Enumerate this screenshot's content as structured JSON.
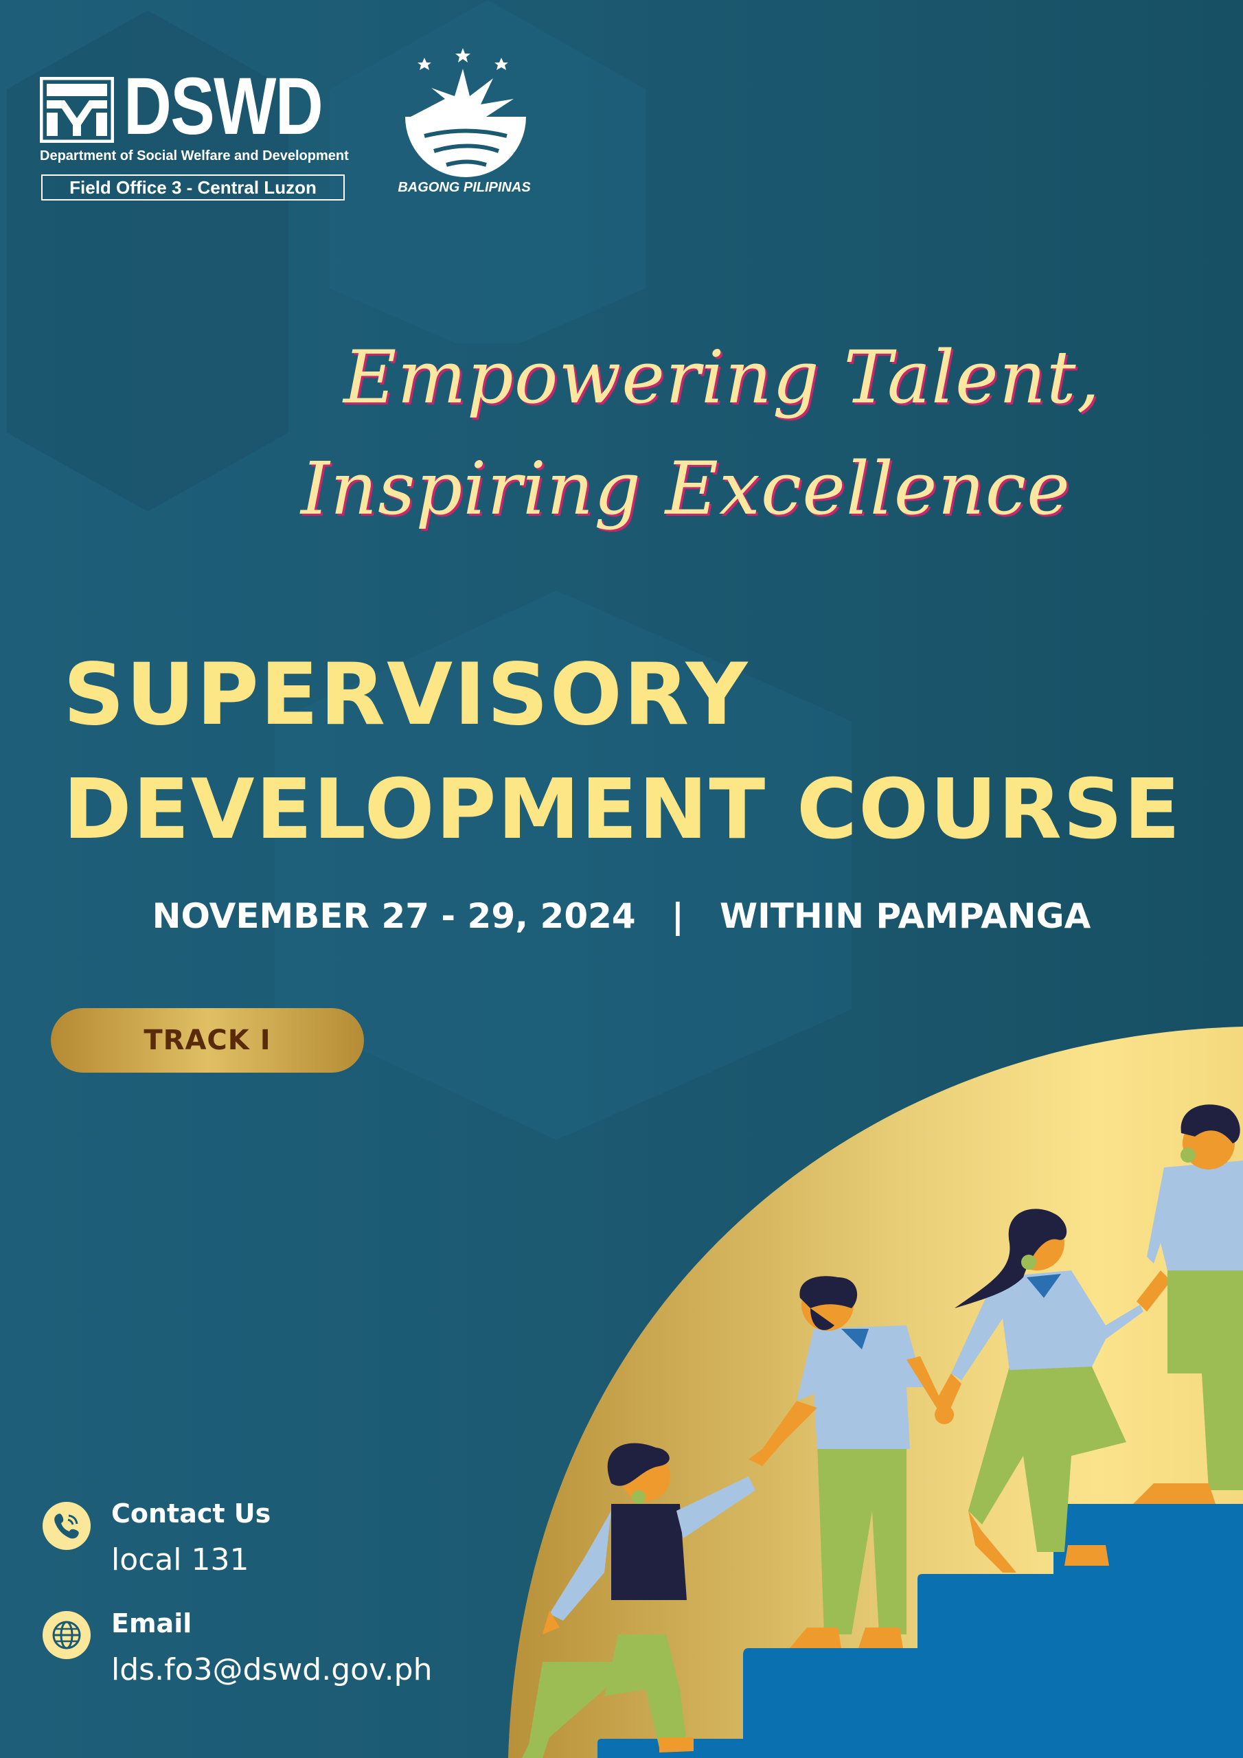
{
  "header": {
    "dswd_wordmark": "DSWD",
    "department": "Department of Social Welfare and Development",
    "field_office": "Field Office 3 - Central Luzon",
    "partner_logo_text": "BAGONG PILIPINAS"
  },
  "tagline": {
    "line1": "Empowering Talent,",
    "line2": "Inspiring Excellence"
  },
  "event": {
    "title_line1": "SUPERVISORY",
    "title_line2": "DEVELOPMENT COURSE",
    "date": "NOVEMBER 27 - 29, 2024",
    "separator": "|",
    "location": "WITHIN PAMPANGA",
    "track": "TRACK I"
  },
  "contact": {
    "phone_label": "Contact Us",
    "phone_value": "local 131",
    "email_label": "Email",
    "email_value": "lds.fo3@dswd.gov.ph"
  },
  "colors": {
    "background": "#1c5a72",
    "title_yellow": "#fde685",
    "tagline_cream": "#fbe7a0",
    "tagline_shadow": "#c8266a",
    "gold": "#d9b55a",
    "stairs_blue": "#0a70b0"
  },
  "icons": {
    "phone": "phone-icon",
    "email": "globe-icon"
  }
}
